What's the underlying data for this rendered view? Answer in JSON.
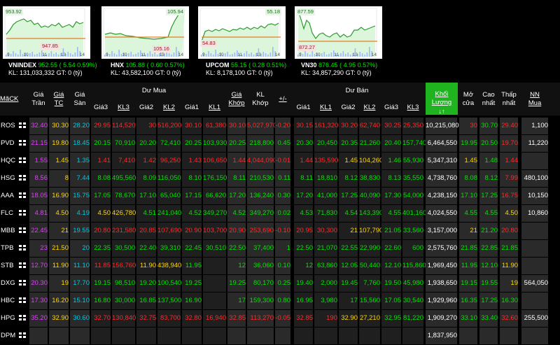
{
  "indices": [
    {
      "chart_high": "953.92",
      "chart_low": "947.85",
      "ticks": [
        "9",
        "10",
        "11",
        "13",
        "14"
      ],
      "name": "VNINDEX",
      "value": "952.55",
      "change": "( 5.54",
      "pct": "0.59%",
      "kl": "KL: 131,033,332",
      "gt": "GT: 0 (tỷ)"
    },
    {
      "chart_high": "105.94",
      "chart_low": "105.16",
      "ticks": [
        "9",
        "10",
        "11",
        "13",
        "14"
      ],
      "name": "HNX",
      "value": "105.88",
      "change": "( 0.60",
      "pct": "0.57%",
      "kl": "KL: 43,582,100",
      "gt": "GT: 0 (tỷ)"
    },
    {
      "chart_high": "55.18",
      "chart_low": "54.83",
      "ticks": [
        "9",
        "10",
        "11",
        "13",
        "14"
      ],
      "name": "UPCOM",
      "value": "55.15",
      "change": "( 0.28",
      "pct": "0.51%",
      "kl": "KL: 8,178,100",
      "gt": "GT: 0 (tỷ)"
    },
    {
      "chart_high": "877.59",
      "chart_low": "872.27",
      "ticks": [
        "9",
        "10",
        "11",
        "13",
        "14"
      ],
      "name": "VN30",
      "value": "876.45",
      "change": "( 4.95",
      "pct": "0.57%",
      "kl": "KL: 34,857,290",
      "gt": "GT: 0 (tỷ)"
    }
  ],
  "header": {
    "mack": "MãCK",
    "tran": "Giá\nTrần",
    "tc": "Giá\nTC",
    "san": "Giá\nSàn",
    "du_mua": "Dư Mua",
    "du_ban": "Dư Bán",
    "gia3": "Giá3",
    "kl3": "KL3",
    "gia2": "Giá2",
    "kl2": "KL2",
    "gia1": "Giá1",
    "kl1": "KL1",
    "gia_khop": "Giá\nKhớp",
    "kl_khop": "KL\nKhớp",
    "pm": "+/-",
    "khoi_luong": "Khối Lượng",
    "sort_icon": "↓↑",
    "mo_cua": "Mở\ncửa",
    "cao_nhat": "Cao\nnhất",
    "thap_nhat": "Thấp\nnhất",
    "nn_mua": "NN\nMua"
  },
  "rows": [
    {
      "sym": "ROS",
      "tran": "32.40",
      "tc": "30.30",
      "san": "28.20",
      "g3": "29.95",
      "k3": "114,520",
      "g2": "30",
      "k2": "516,200",
      "g1": "30.10",
      "k1": "61,380",
      "gk": "30.10",
      "kk": "5,027,970",
      "pm": "-0.20",
      "sg1": "30.15",
      "sk1": "161,320",
      "sg2": "30.20",
      "sk2": "62,740",
      "sg3": "30.25",
      "sk3": "25,350",
      "vol": "10,215,080",
      "mo": "30",
      "cao": "30.70",
      "thap": "29.40",
      "nn": "1,100",
      "c": {
        "g3": "dn",
        "g2": "dn",
        "g1": "dn",
        "gk": "dn",
        "pm": "dn",
        "sg1": "dn",
        "sg2": "dn",
        "sg3": "dn",
        "mo": "dn",
        "cao": "up",
        "thap": "dn"
      }
    },
    {
      "sym": "PVD",
      "tran": "21.15",
      "tc": "19.80",
      "san": "18.45",
      "g3": "20.15",
      "k3": "70,910",
      "g2": "20.20",
      "k2": "72,410",
      "g1": "20.25",
      "k1": "103,930",
      "gk": "20.25",
      "kk": "218,800",
      "pm": "0.45",
      "sg1": "20.30",
      "sk1": "20,450",
      "sg2": "20.35",
      "sk2": "21,260",
      "sg3": "20.40",
      "sk3": "157,740",
      "vol": "6,464,550",
      "mo": "19.95",
      "cao": "20.50",
      "thap": "19.70",
      "nn": "11,220",
      "c": {
        "g3": "up",
        "g2": "up",
        "g1": "up",
        "gk": "up",
        "pm": "up",
        "sg1": "up",
        "sg2": "up",
        "sg3": "up",
        "mo": "up",
        "cao": "up",
        "thap": "dn"
      }
    },
    {
      "sym": "HQC",
      "tran": "1.55",
      "tc": "1.45",
      "san": "1.35",
      "g3": "1.41",
      "k3": "7,410",
      "g2": "1.42",
      "k2": "96,250",
      "g1": "1.43",
      "k1": "106,650",
      "gk": "1.44",
      "kk": "4,044,090",
      "pm": "-0.01",
      "sg1": "1.44",
      "sk1": "135,590",
      "sg2": "1.45",
      "sk2": "104,260",
      "sg3": "1.46",
      "sk3": "55,930",
      "vol": "5,347,310",
      "mo": "1.45",
      "cao": "1.48",
      "thap": "1.44",
      "nn": "",
      "c": {
        "g3": "dn",
        "g2": "dn",
        "g1": "dn",
        "gk": "dn",
        "pm": "dn",
        "sg1": "dn",
        "sg2": "ref",
        "sg3": "up",
        "mo": "ref",
        "cao": "up",
        "thap": "dn"
      }
    },
    {
      "sym": "HSG",
      "tran": "8.56",
      "tc": "8",
      "san": "7.44",
      "g3": "8.08",
      "k3": "495,560",
      "g2": "8.09",
      "k2": "116,050",
      "g1": "8.10",
      "k1": "176,150",
      "gk": "8.11",
      "kk": "210,530",
      "pm": "0.11",
      "sg1": "8.11",
      "sk1": "18,810",
      "sg2": "8.12",
      "sk2": "38,830",
      "sg3": "8.13",
      "sk3": "35,550",
      "vol": "4,738,760",
      "mo": "8.08",
      "cao": "8.12",
      "thap": "7.99",
      "nn": "480,100",
      "c": {
        "g3": "up",
        "g2": "up",
        "g1": "up",
        "gk": "up",
        "pm": "up",
        "sg1": "up",
        "sg2": "up",
        "sg3": "up",
        "mo": "up",
        "cao": "up",
        "thap": "dn"
      }
    },
    {
      "sym": "AAA",
      "tran": "18.05",
      "tc": "16.90",
      "san": "15.75",
      "g3": "17.05",
      "k3": "78,670",
      "g2": "17.10",
      "k2": "65,040",
      "g1": "17.15",
      "k1": "66,620",
      "gk": "17.20",
      "kk": "136,240",
      "pm": "0.30",
      "sg1": "17.20",
      "sk1": "41,000",
      "sg2": "17.25",
      "sk2": "40,090",
      "sg3": "17.30",
      "sk3": "54,000",
      "vol": "4,238,150",
      "mo": "17.10",
      "cao": "17.25",
      "thap": "16.75",
      "nn": "10,150",
      "c": {
        "g3": "up",
        "g2": "up",
        "g1": "up",
        "gk": "up",
        "pm": "up",
        "sg1": "up",
        "sg2": "up",
        "sg3": "up",
        "mo": "up",
        "cao": "up",
        "thap": "dn"
      }
    },
    {
      "sym": "FLC",
      "tran": "4.81",
      "tc": "4.50",
      "san": "4.19",
      "g3": "4.50",
      "k3": "426,780",
      "g2": "4.51",
      "k2": "241,040",
      "g1": "4.52",
      "k1": "349,270",
      "gk": "4.52",
      "kk": "349,270",
      "pm": "0.02",
      "sg1": "4.53",
      "sk1": "71,830",
      "sg2": "4.54",
      "sk2": "143,390",
      "sg3": "4.55",
      "sk3": "401,160",
      "vol": "4,024,550",
      "mo": "4.55",
      "cao": "4.55",
      "thap": "4.50",
      "nn": "10,860",
      "c": {
        "g3": "ref",
        "g2": "up",
        "g1": "up",
        "gk": "up",
        "pm": "up",
        "sg1": "up",
        "sg2": "up",
        "sg3": "up",
        "mo": "up",
        "cao": "up",
        "thap": "ref"
      }
    },
    {
      "sym": "MBB",
      "tran": "22.45",
      "tc": "21",
      "san": "19.55",
      "g3": "20.80",
      "k3": "231,580",
      "g2": "20.85",
      "k2": "107,690",
      "g1": "20.90",
      "k1": "103,700",
      "gk": "20.90",
      "kk": "253,690",
      "pm": "-0.10",
      "sg1": "20.95",
      "sk1": "30,300",
      "sg2": "21",
      "sk2": "107,790",
      "sg3": "21.05",
      "sk3": "33,560",
      "vol": "3,157,000",
      "mo": "21",
      "cao": "21.20",
      "thap": "20.80",
      "nn": "",
      "c": {
        "g3": "dn",
        "g2": "dn",
        "g1": "dn",
        "gk": "dn",
        "pm": "dn",
        "sg1": "dn",
        "sg2": "ref",
        "sg3": "up",
        "mo": "ref",
        "cao": "up",
        "thap": "dn"
      }
    },
    {
      "sym": "TPB",
      "tran": "23",
      "tc": "21.50",
      "san": "20",
      "g3": "22.35",
      "k3": "30,500",
      "g2": "22.40",
      "k2": "39,310",
      "g1": "22.45",
      "k1": "30,510",
      "gk": "22.50",
      "kk": "37,400",
      "pm": "1",
      "sg1": "22.50",
      "sk1": "21,070",
      "sg2": "22.55",
      "sk2": "22,990",
      "sg3": "22.60",
      "sk3": "600",
      "vol": "2,575,760",
      "mo": "21.85",
      "cao": "22.85",
      "thap": "21.85",
      "nn": "",
      "c": {
        "g3": "up",
        "g2": "up",
        "g1": "up",
        "gk": "up",
        "pm": "up",
        "sg1": "up",
        "sg2": "up",
        "sg3": "up",
        "mo": "up",
        "cao": "up",
        "thap": "up"
      }
    },
    {
      "sym": "STB",
      "tran": "12.70",
      "tc": "11.90",
      "san": "11.10",
      "g3": "11.85",
      "k3": "156,760",
      "g2": "11.90",
      "k2": "438,940",
      "g1": "11.95",
      "k1": "",
      "gk": "12",
      "kk": "36,060",
      "pm": "0.10",
      "sg1": "12",
      "sk1": "63,860",
      "sg2": "12.05",
      "sk2": "50,440",
      "sg3": "12.10",
      "sk3": "115,860",
      "vol": "1,969,450",
      "mo": "11.95",
      "cao": "12.10",
      "thap": "11.90",
      "nn": "",
      "c": {
        "g3": "dn",
        "g2": "ref",
        "g1": "up",
        "gk": "up",
        "pm": "up",
        "sg1": "up",
        "sg2": "up",
        "sg3": "up",
        "mo": "up",
        "cao": "up",
        "thap": "ref"
      }
    },
    {
      "sym": "DXG",
      "tran": "20.30",
      "tc": "19",
      "san": "17.70",
      "g3": "19.15",
      "k3": "98,510",
      "g2": "19.20",
      "k2": "100,540",
      "g1": "19.25",
      "k1": "",
      "gk": "19.25",
      "kk": "80,170",
      "pm": "0.25",
      "sg1": "19.40",
      "sk1": "2,000",
      "sg2": "19.45",
      "sk2": "7,760",
      "sg3": "19.50",
      "sk3": "45,980",
      "vol": "1,938,650",
      "mo": "19.15",
      "cao": "19.55",
      "thap": "19",
      "nn": "564,050",
      "c": {
        "g3": "up",
        "g2": "up",
        "g1": "up",
        "gk": "up",
        "pm": "up",
        "sg1": "up",
        "sg2": "up",
        "sg3": "up",
        "mo": "up",
        "cao": "up",
        "thap": "ref"
      }
    },
    {
      "sym": "HBC",
      "tran": "17.30",
      "tc": "16.20",
      "san": "15.10",
      "g3": "16.80",
      "k3": "30,000",
      "g2": "16.85",
      "k2": "137,500",
      "g1": "16.90",
      "k1": "",
      "gk": "17",
      "kk": "159,300",
      "pm": "0.80",
      "sg1": "16.95",
      "sk1": "3,980",
      "sg2": "17",
      "sk2": "15,560",
      "sg3": "17.05",
      "sk3": "30,540",
      "vol": "1,929,960",
      "mo": "16.35",
      "cao": "17.25",
      "thap": "16.30",
      "nn": "",
      "c": {
        "g3": "up",
        "g2": "up",
        "g1": "up",
        "gk": "up",
        "pm": "up",
        "sg1": "up",
        "sg2": "up",
        "sg3": "up",
        "mo": "up",
        "cao": "up",
        "thap": "up"
      }
    },
    {
      "sym": "HPG",
      "tran": "35.20",
      "tc": "32.90",
      "san": "30.60",
      "g3": "32.70",
      "k3": "130,840",
      "g2": "32.75",
      "k2": "83,700",
      "g1": "32.80",
      "k1": "16,940",
      "gk": "32.85",
      "kk": "113,270",
      "pm": "-0.05",
      "sg1": "32.85",
      "sk1": "190",
      "sg2": "32.90",
      "sk2": "27,210",
      "sg3": "32.95",
      "sk3": "81,220",
      "vol": "1,909,270",
      "mo": "33.10",
      "cao": "33.40",
      "thap": "32.60",
      "nn": "255,500",
      "c": {
        "g3": "dn",
        "g2": "dn",
        "g1": "dn",
        "gk": "dn",
        "pm": "dn",
        "sg1": "dn",
        "sg2": "ref",
        "sg3": "up",
        "mo": "up",
        "cao": "up",
        "thap": "dn"
      }
    },
    {
      "sym": "DPM",
      "tran": "",
      "tc": "",
      "san": "",
      "g3": "",
      "k3": "",
      "g2": "",
      "k2": "",
      "g1": "",
      "k1": "",
      "gk": "",
      "kk": "",
      "pm": "",
      "sg1": "",
      "sk1": "",
      "sg2": "",
      "sk2": "",
      "sg3": "",
      "sk3": "",
      "vol": "1,837,950",
      "mo": "",
      "cao": "",
      "thap": "",
      "nn": "",
      "c": {}
    }
  ],
  "colors": {
    "up": "#00e400",
    "down": "#ff2a2a",
    "ref": "#ffd700",
    "ceiling": "#e040fb",
    "floor": "#00c8e0",
    "accent": "#1fb41f"
  }
}
